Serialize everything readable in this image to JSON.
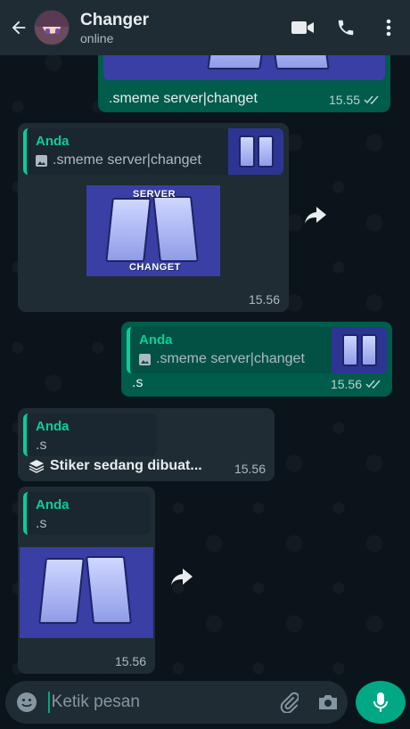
{
  "header": {
    "title": "Changer",
    "subtitle": "online",
    "icons": [
      "back-arrow-icon",
      "video-call-icon",
      "phone-icon",
      "more-vert-icon"
    ]
  },
  "messages": [
    {
      "text": ".smeme server|changet",
      "time": "15.55",
      "status": "read"
    },
    {
      "quote_name": "Anda",
      "quote_text": ".smeme server|changet",
      "image_labels": [
        "SERVER",
        "CHANGET"
      ],
      "time": "15.56"
    },
    {
      "quote_name": "Anda",
      "quote_text": ".smeme server|changet",
      "text": ".s",
      "time": "15.56",
      "status": "read"
    },
    {
      "quote_name": "Anda",
      "quote_text": ".s",
      "text": "Stiker sedang dibuat...",
      "time": "15.56"
    },
    {
      "quote_name": "Anda",
      "quote_text": ".s",
      "time": "15.56"
    }
  ],
  "input": {
    "placeholder": "Ketik pesan"
  },
  "colors": {
    "accent": "#00a884",
    "header_bg": "#1f2c34",
    "outgoing": "#005c4b",
    "incoming": "#202c33",
    "quote_name": "#06cf9c"
  }
}
